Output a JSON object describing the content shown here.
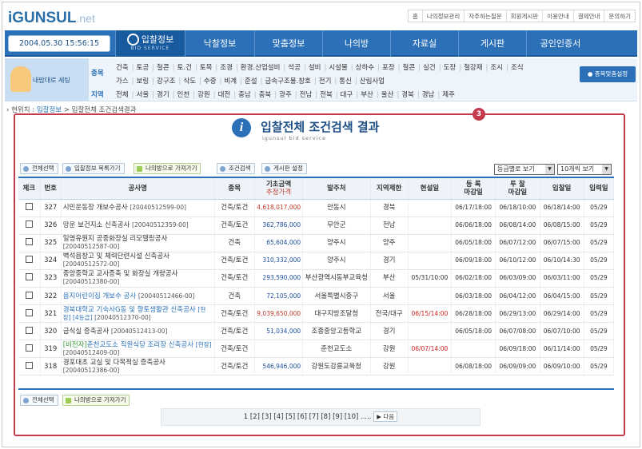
{
  "logo": {
    "main": "iGUNSUL",
    "suffix": ".net"
  },
  "toplinks": [
    "홈",
    "나의정보관리",
    "자주하는질문",
    "회원게시판",
    "이용안내",
    "결제안내",
    "문의하기"
  ],
  "clock": "2004.05.30 15:56:15",
  "nav": {
    "active": {
      "label": "입찰정보",
      "sub": "BID SERVICE"
    },
    "tabs": [
      "낙찰정보",
      "맞춤정보",
      "나의방",
      "자료실",
      "게시판",
      "공인인증서"
    ]
  },
  "mydesk": {
    "label": "내맘대로 세팅"
  },
  "categories": {
    "type_label": "종목",
    "row1": [
      "건축",
      "토공",
      "철콘",
      "토.건",
      "토목",
      "조경",
      "환경.산업설비",
      "석공",
      "설비",
      "시설물",
      "상하수",
      "포장",
      "철콘",
      "실건",
      "도장",
      "철강재",
      "조시",
      "조식"
    ],
    "row2": [
      "가스",
      "보링",
      "강구조",
      "삭도",
      "수중",
      "비계",
      "준설",
      "금속구조물.창호",
      "전기",
      "통신",
      "산림사업"
    ],
    "region_label": "지역",
    "regions": [
      "전체",
      "서울",
      "경기",
      "인천",
      "강원",
      "대전",
      "충남",
      "충북",
      "광주",
      "전남",
      "전북",
      "대구",
      "부산",
      "울산",
      "경북",
      "경남",
      "제주"
    ],
    "match_button": "종목맞춤설정"
  },
  "breadcrumb": {
    "prefix": "현위치 :",
    "current": "입찰정보",
    "sep": ">",
    "page": "입찰전체 조건검색결과"
  },
  "badge": "3",
  "title": {
    "main": "입찰전체 조건검색 결과",
    "sub": "igunsul bid service"
  },
  "toolbar": {
    "select_all": "전체선택",
    "bid_list": "입찰정보 목록가기",
    "to_myroom": "나의방으로 가져가기",
    "search": "조건검색",
    "board_settings": "게시판 설정",
    "sort": "등급별로 보기",
    "per_page": "10개씩 보기"
  },
  "columns": {
    "check": "체크",
    "no": "번호",
    "name": "공사명",
    "type": "종목",
    "price1": "기초금액",
    "price2": "추정가격",
    "org": "발주처",
    "region": "지역제한",
    "site": "현설일",
    "reg1": "등  록",
    "reg2": "마감일",
    "bid1": "투  찰",
    "bid2": "마감일",
    "open": "입찰일",
    "input": "입력일"
  },
  "rows": [
    {
      "no": "327",
      "name": "시민운동장 개보수공사",
      "code": "[20040512599-00]",
      "type": "건축/토건",
      "price": "4,618,017,000",
      "org": "안동시",
      "region": "경북",
      "site": "",
      "reg": "06/17/18:00",
      "bid": "06/18/10:00",
      "open": "06/18/14:00",
      "input": "05/29"
    },
    {
      "no": "326",
      "name": "망운 보건지소 신축공사",
      "code": "[20040512359-00]",
      "type": "건축/토건",
      "price": "362,786,000",
      "org": "무안군",
      "region": "전남",
      "site": "",
      "reg": "06/06/18:00",
      "bid": "06/08/14:00",
      "open": "06/08/15:00",
      "input": "05/29"
    },
    {
      "no": "325",
      "name": "일영유원지 공중화장실 리모델링공사",
      "code": "[20040512587-00]",
      "type": "건축",
      "price": "65,604,000",
      "org": "양주시",
      "region": "양주",
      "site": "",
      "reg": "06/05/18:00",
      "bid": "06/07/12:00",
      "open": "06/07/15:00",
      "input": "05/29"
    },
    {
      "no": "324",
      "name": "벽석읍창고 및 체력단련시설 신축공사",
      "code": "[20040512572-00]",
      "type": "건축/토건",
      "price": "310,332,000",
      "org": "양주시",
      "region": "경기",
      "site": "",
      "reg": "06/09/18:00",
      "bid": "06/10/12:00",
      "open": "06/10/14:30",
      "input": "05/29"
    },
    {
      "no": "323",
      "name": "중앙중학교 교사증축 및 화장실 개량공사",
      "code": "[20040512380-00]",
      "type": "건축/토건",
      "price": "293,590,000",
      "org": "부산광역시동부교육청",
      "region": "부산",
      "site": "05/31/10:00",
      "reg": "06/02/18:00",
      "bid": "06/03/09:00",
      "open": "06/03/11:00",
      "input": "05/29"
    },
    {
      "no": "322",
      "name": "음지어린이집 개보수 공사",
      "code": "[20040512466-00]",
      "type": "건축",
      "price": "72,105,000",
      "org": "서울특별시중구",
      "region": "서울",
      "site": "",
      "reg": "06/03/18:00",
      "bid": "06/04/12:00",
      "open": "06/04/15:00",
      "input": "05/29"
    },
    {
      "no": "321",
      "name": "경북대학교 기숙사G동 및 향토생활관 신축공사",
      "tag": "[현장] [4등급]",
      "code": "[20040512370-00]",
      "type": "건축/토건",
      "price": "9,039,650,000",
      "org": "대구지방조달청",
      "region": "전국/대구",
      "site": "06/15/14:00",
      "reg": "06/28/18:00",
      "bid": "06/29/13:00",
      "open": "06/29/14:00",
      "input": "05/29"
    },
    {
      "no": "320",
      "name": "금식실 증축공사",
      "code": "[20040512413-00]",
      "type": "건축/토건",
      "price": "51,034,000",
      "org": "조종중앙고등학교",
      "region": "경기",
      "site": "",
      "reg": "06/05/18:00",
      "bid": "06/07/08:00",
      "open": "06/07/10:00",
      "input": "05/29"
    },
    {
      "no": "319",
      "pre": "[비전자]",
      "name": "춘천교도소 직원식당 조리장 신축공사",
      "tag": "[현장]",
      "code": "[20040512409-00]",
      "type": "건축/토건",
      "price": "",
      "org": "춘천교도소",
      "region": "강원",
      "site": "06/07/14:00",
      "reg": "",
      "bid": "06/09/18:00",
      "open": "06/11/14:00",
      "input": "05/29"
    },
    {
      "no": "318",
      "name": "경포대초 교실 및 다목적실 증축공사",
      "code": "[20040512386-00]",
      "type": "건축/토건",
      "price": "546,946,000",
      "org": "강원도강릉교육청",
      "region": "강원",
      "site": "",
      "reg": "06/08/18:00",
      "bid": "06/09/09:00",
      "open": "06/09/10:00",
      "input": "05/29"
    }
  ],
  "bottom": {
    "select_all": "전체선택",
    "to_myroom": "나의방으로 가져가기"
  },
  "pager": {
    "pages": "1 [2] [3] [4] [5] [6] [7] [8] [9] [10]",
    "dots": ".....",
    "next": "다음"
  }
}
